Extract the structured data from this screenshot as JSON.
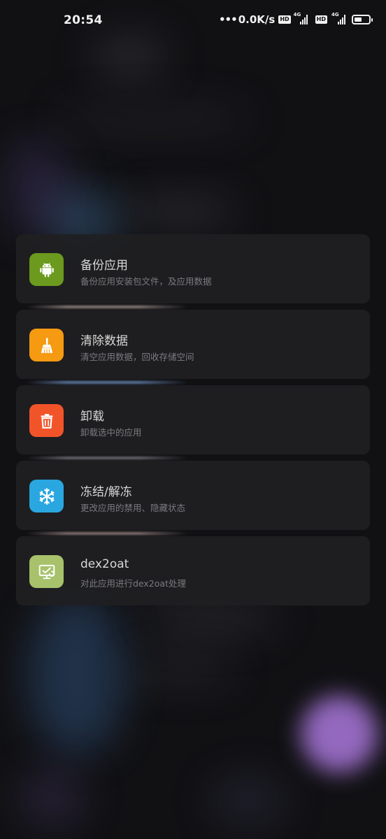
{
  "status_bar": {
    "time": "20:54",
    "dots": "•••",
    "net_speed": "0.0K/s",
    "sim1_badge": "HD",
    "sim1_network": "4G",
    "sim2_badge": "HD",
    "sim2_network": "4G",
    "battery_level": 0.55,
    "icons": [
      "hd-icon",
      "signal-icon",
      "hd-icon",
      "signal-icon",
      "battery-icon"
    ]
  },
  "menu": {
    "items": [
      {
        "title": "备份应用",
        "subtitle": "备份应用安装包文件，及应用数据",
        "icon": "android-icon",
        "icon_color": "#6b9a1e",
        "divider_color": "#b9a9a0"
      },
      {
        "title": "清除数据",
        "subtitle": "清空应用数据，回收存储空间",
        "icon": "broom-icon",
        "icon_color": "#f59a11",
        "divider_color": "#7ea2d6"
      },
      {
        "title": "卸载",
        "subtitle": "卸载选中的应用",
        "icon": "trash-icon",
        "icon_color": "#f2542a",
        "divider_color": "#8c8c92"
      },
      {
        "title": "冻结/解冻",
        "subtitle": "更改应用的禁用、隐藏状态",
        "icon": "snowflake-icon",
        "icon_color": "#2aa6e0",
        "divider_color": "#b29a98"
      },
      {
        "title": "dex2oat",
        "subtitle": "对此应用进行dex2oat处理",
        "icon": "monitor-refresh-icon",
        "icon_color": "#a7c26b",
        "divider_color": "transparent"
      }
    ]
  }
}
